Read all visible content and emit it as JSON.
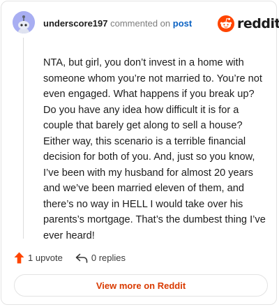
{
  "header": {
    "username": "underscore197",
    "commented_text": "commented on",
    "post_link": "post"
  },
  "brand": {
    "logo_text": "reddit",
    "accent_color": "#ff4500"
  },
  "comment": {
    "body": "NTA, but girl, you don’t invest in a home with someone whom you’re not married to. You’re not even engaged. What happens if you break up? Do you have any idea how difficult it is for a couple that barely get along to sell a house? Either way, this scenario is a terrible financial decision for both of you. And, just so you know, I’ve been with my husband for almost 20 years and we’ve been married eleven of them, and there’s no way in HELL I would take over his parents’s mortgage. That’s the dumbest thing I’ve ever heard!"
  },
  "actions": {
    "upvotes": "1 upvote",
    "replies": "0 replies"
  },
  "footer": {
    "view_more_label": "View more on Reddit",
    "view_more_color": "#d93a00"
  },
  "icons": [
    "avatar-snoo-icon",
    "reddit-logo-icon",
    "upvote-arrow-icon",
    "reply-arrow-icon"
  ]
}
